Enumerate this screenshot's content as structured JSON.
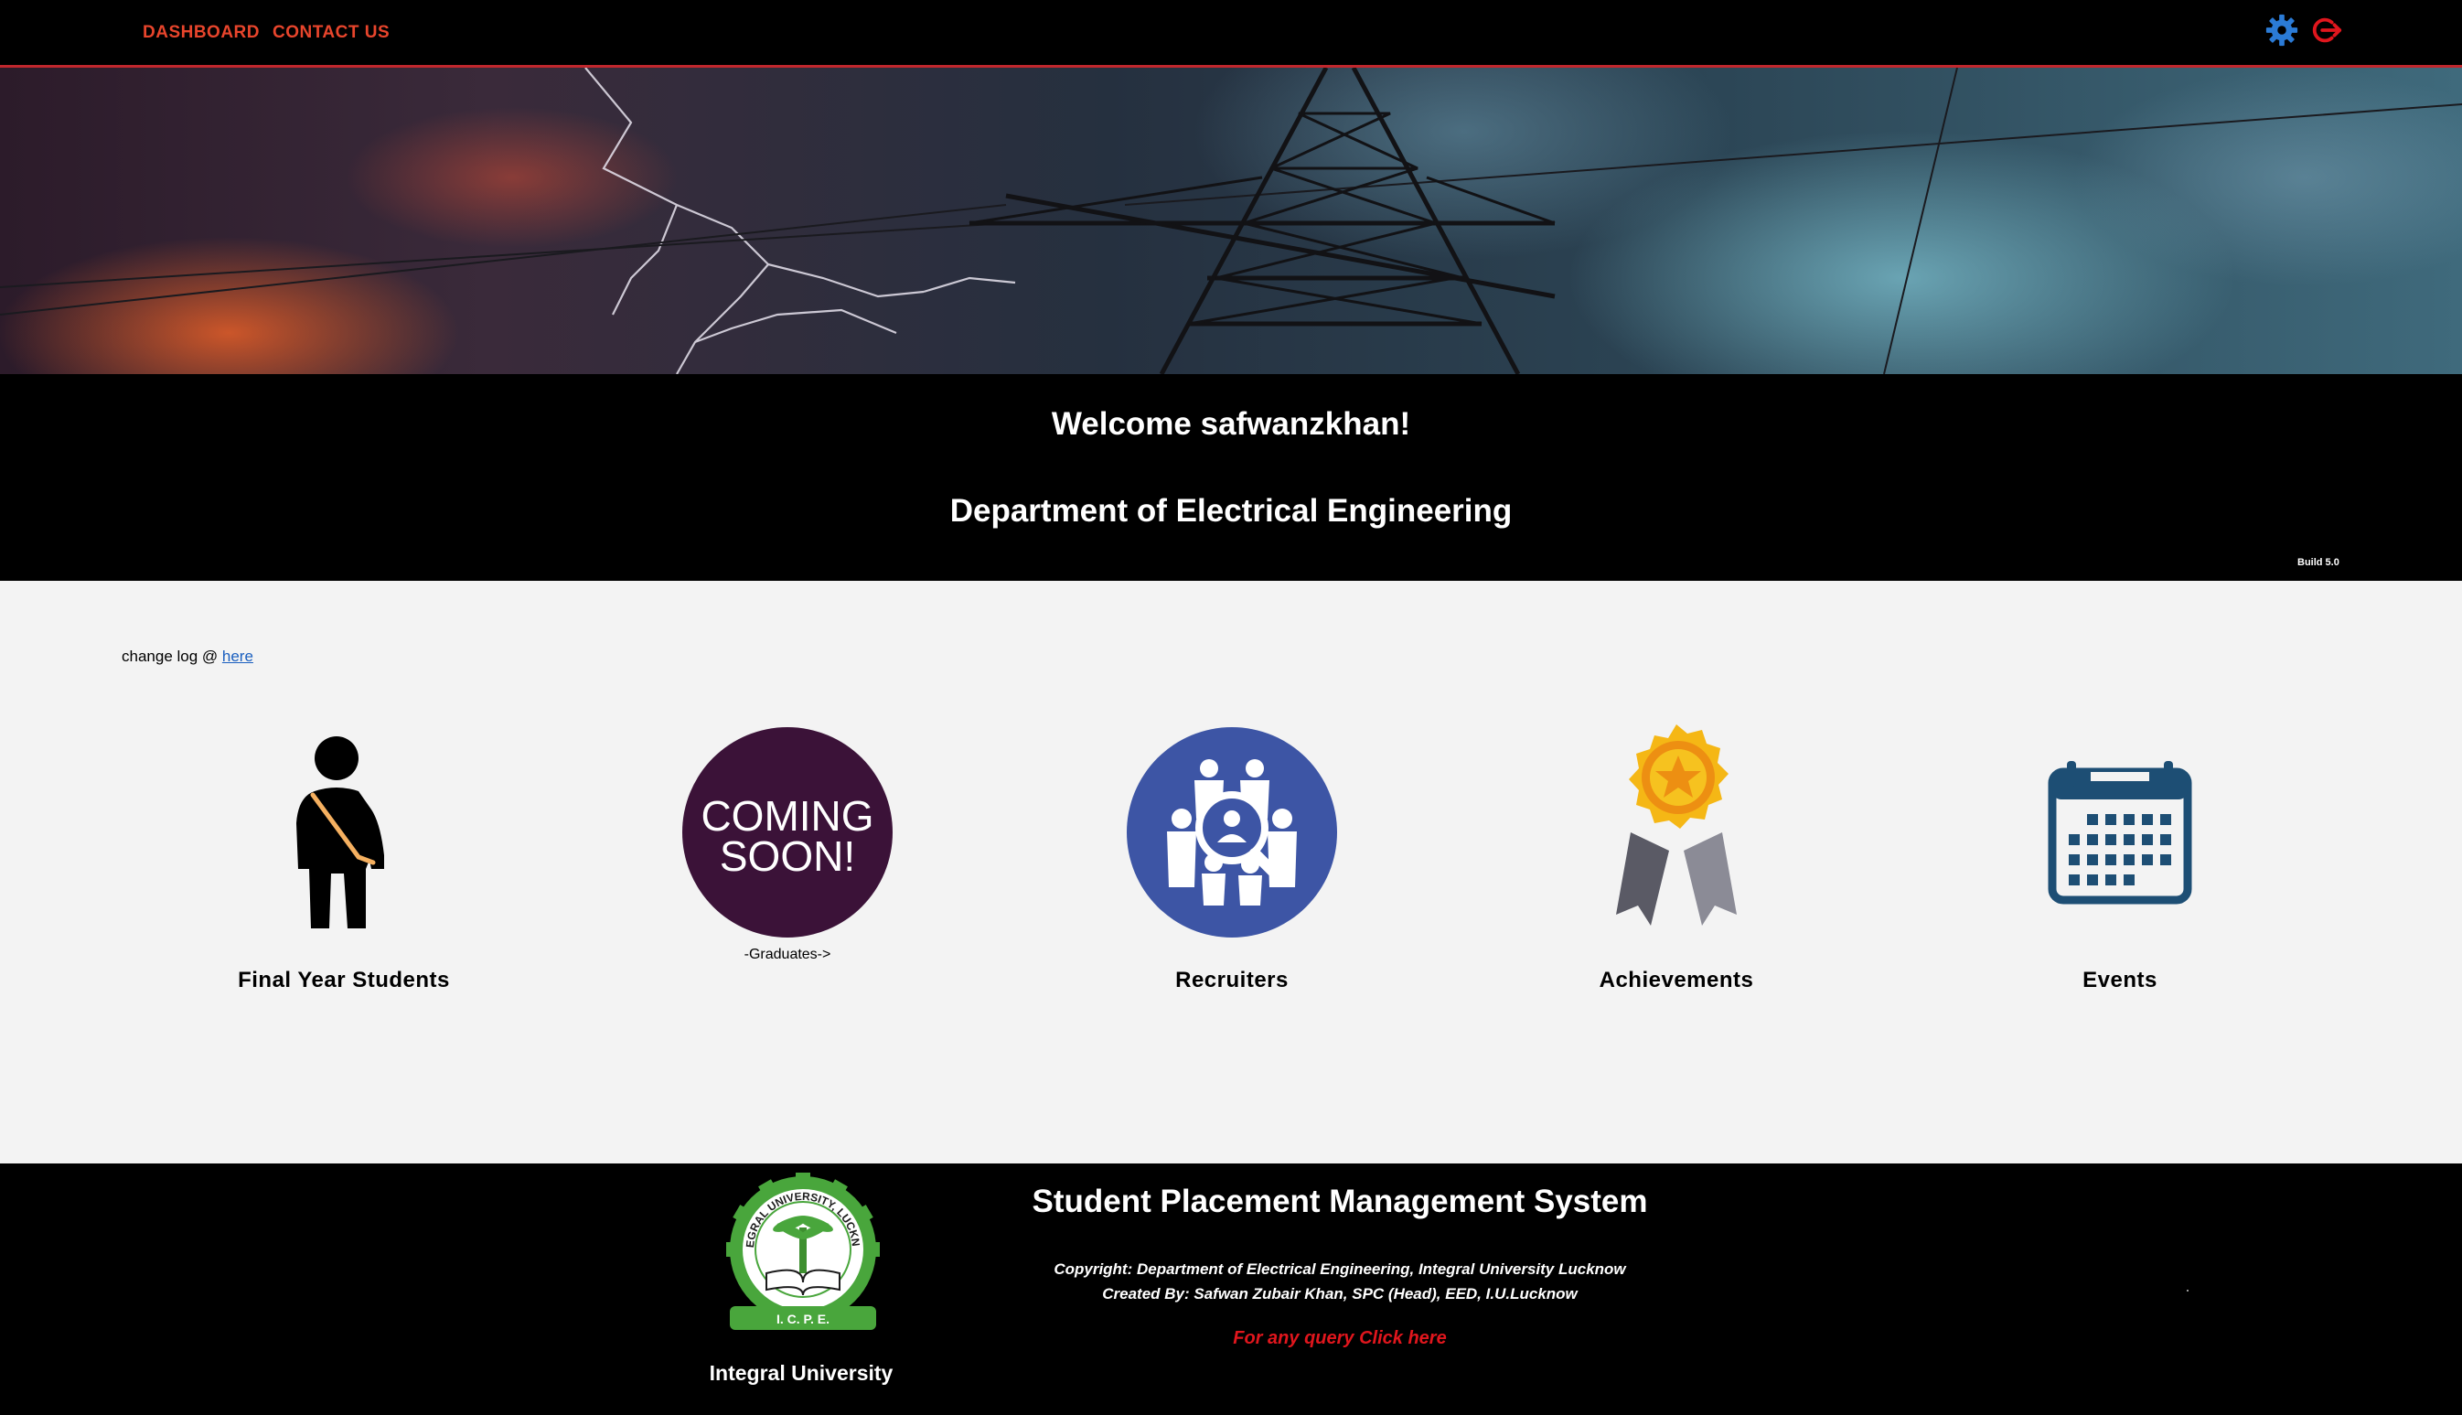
{
  "nav": {
    "dashboard": "DASHBOARD",
    "contact": "CONTACT US",
    "settings_icon": "gear-icon",
    "logout_icon": "logout-icon"
  },
  "welcome": {
    "greeting": "Welcome safwanzkhan!",
    "department": "Department of Electrical Engineering",
    "build": "Build 5.0"
  },
  "changelog": {
    "prefix": "change log @ ",
    "link": "here"
  },
  "cards": [
    {
      "label": "Final Year Students",
      "icon": "student-icon"
    },
    {
      "label": "",
      "icon": "coming-soon-badge",
      "badge_line1": "COMING",
      "badge_line2": "SOON!",
      "sublabel": "-Graduates->"
    },
    {
      "label": "Recruiters",
      "icon": "recruiters-icon"
    },
    {
      "label": "Achievements",
      "icon": "award-medal-icon"
    },
    {
      "label": "Events",
      "icon": "calendar-icon"
    }
  ],
  "footer": {
    "university": "Integral University",
    "logo_text": "INTEGRAL UNIVERSITY, LUCKNOW",
    "logo_initials": "I. C. P. E.",
    "system_title": "Student Placement Management System",
    "copyright": "Copyright: Department of Electrical Engineering, Integral University Lucknow",
    "created_by": "Created By: Safwan Zubair Khan, SPC (Head), EED, I.U.Lucknow",
    "query": "For any query Click here"
  },
  "colors": {
    "nav_accent": "#e8452c",
    "nav_border": "#c0272d",
    "gear": "#2b7bd6",
    "coming_soon_bg": "#3b1238",
    "recruiters_bg": "#3d55a5",
    "calendar": "#1d4e74",
    "medal_gold": "#f5b715",
    "query_red": "#e0161d"
  }
}
